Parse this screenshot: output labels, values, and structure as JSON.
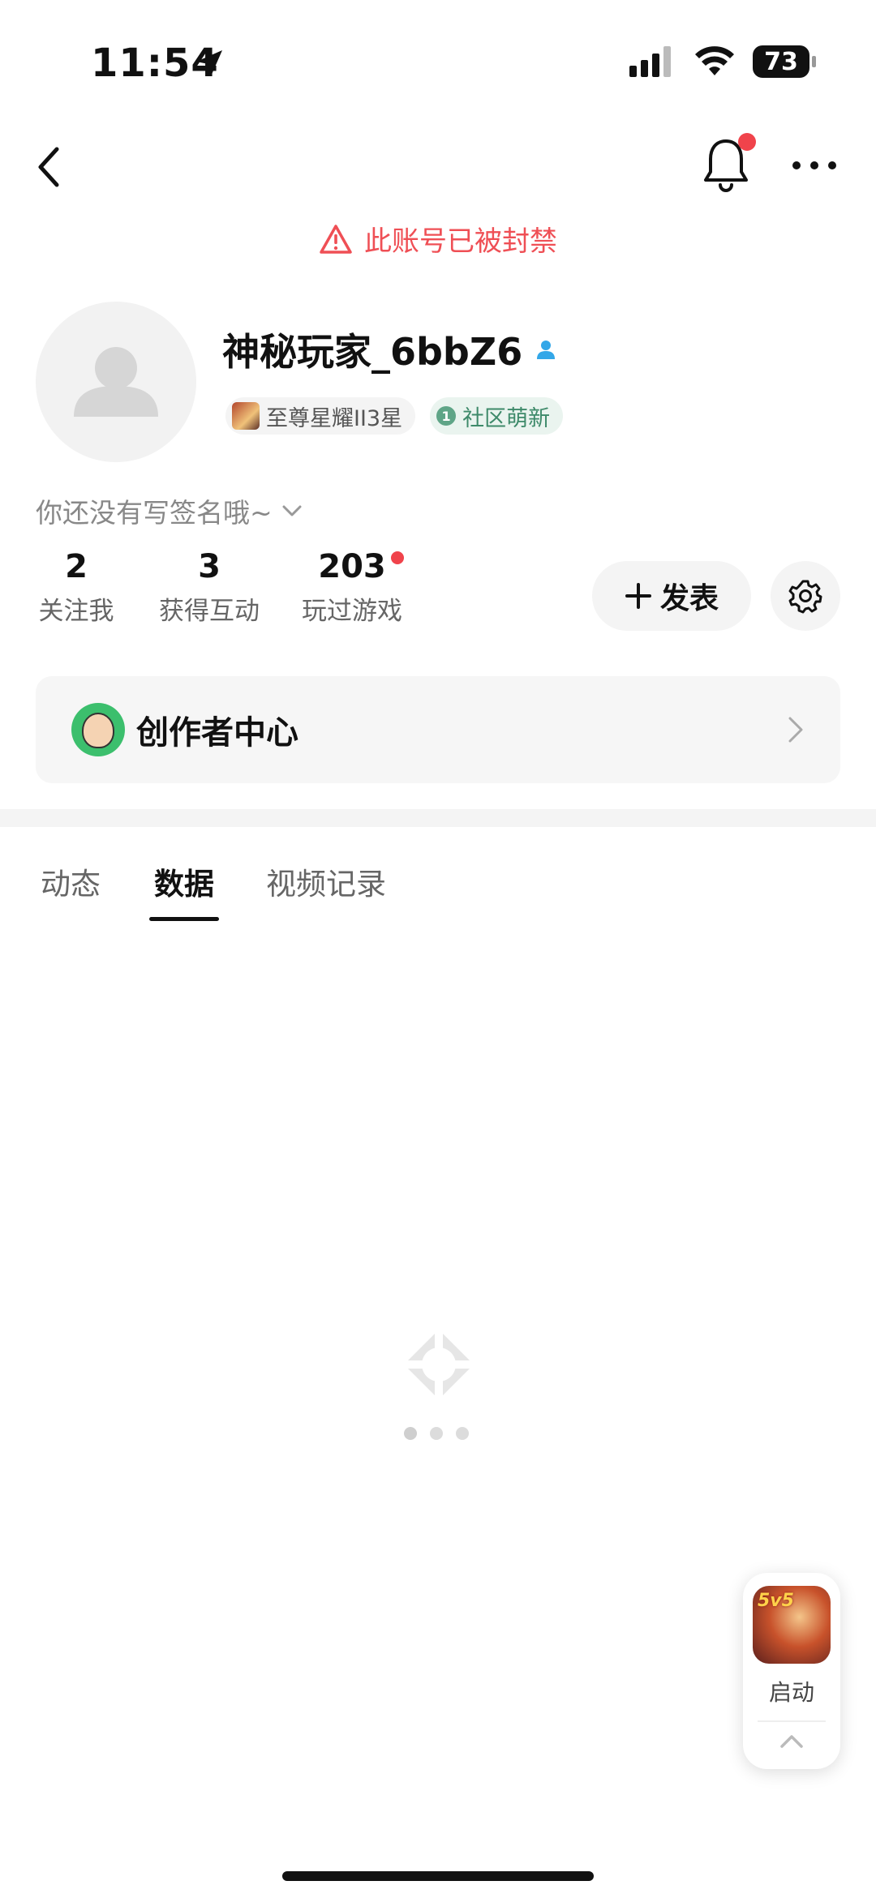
{
  "status_bar": {
    "time": "11:54",
    "battery": "73"
  },
  "notice": {
    "text": "此账号已被封禁",
    "color": "#ef4f55"
  },
  "profile": {
    "username": "神秘玩家_6bbZ6",
    "badges": {
      "rank": "至尊星耀II3星",
      "community_level": "1",
      "community": "社区萌新"
    },
    "signature": "你还没有写签名哦~"
  },
  "stats": [
    {
      "value": "2",
      "label": "关注我"
    },
    {
      "value": "3",
      "label": "获得互动"
    },
    {
      "value": "203",
      "label": "玩过游戏"
    }
  ],
  "actions": {
    "publish": "发表"
  },
  "creator_center": {
    "label": "创作者中心"
  },
  "tabs": [
    {
      "label": "动态",
      "active": false
    },
    {
      "label": "数据",
      "active": true
    },
    {
      "label": "视频记录",
      "active": false
    }
  ],
  "launch_widget": {
    "game_badge": "5v5",
    "label": "启动"
  },
  "icons": {
    "back": "back-arrow-icon",
    "bell": "bell-icon",
    "more": "more-icon",
    "settings": "gear-icon",
    "warning": "warning-icon",
    "chevron": "chevron-right-icon"
  },
  "accent_red": "#f0434b"
}
